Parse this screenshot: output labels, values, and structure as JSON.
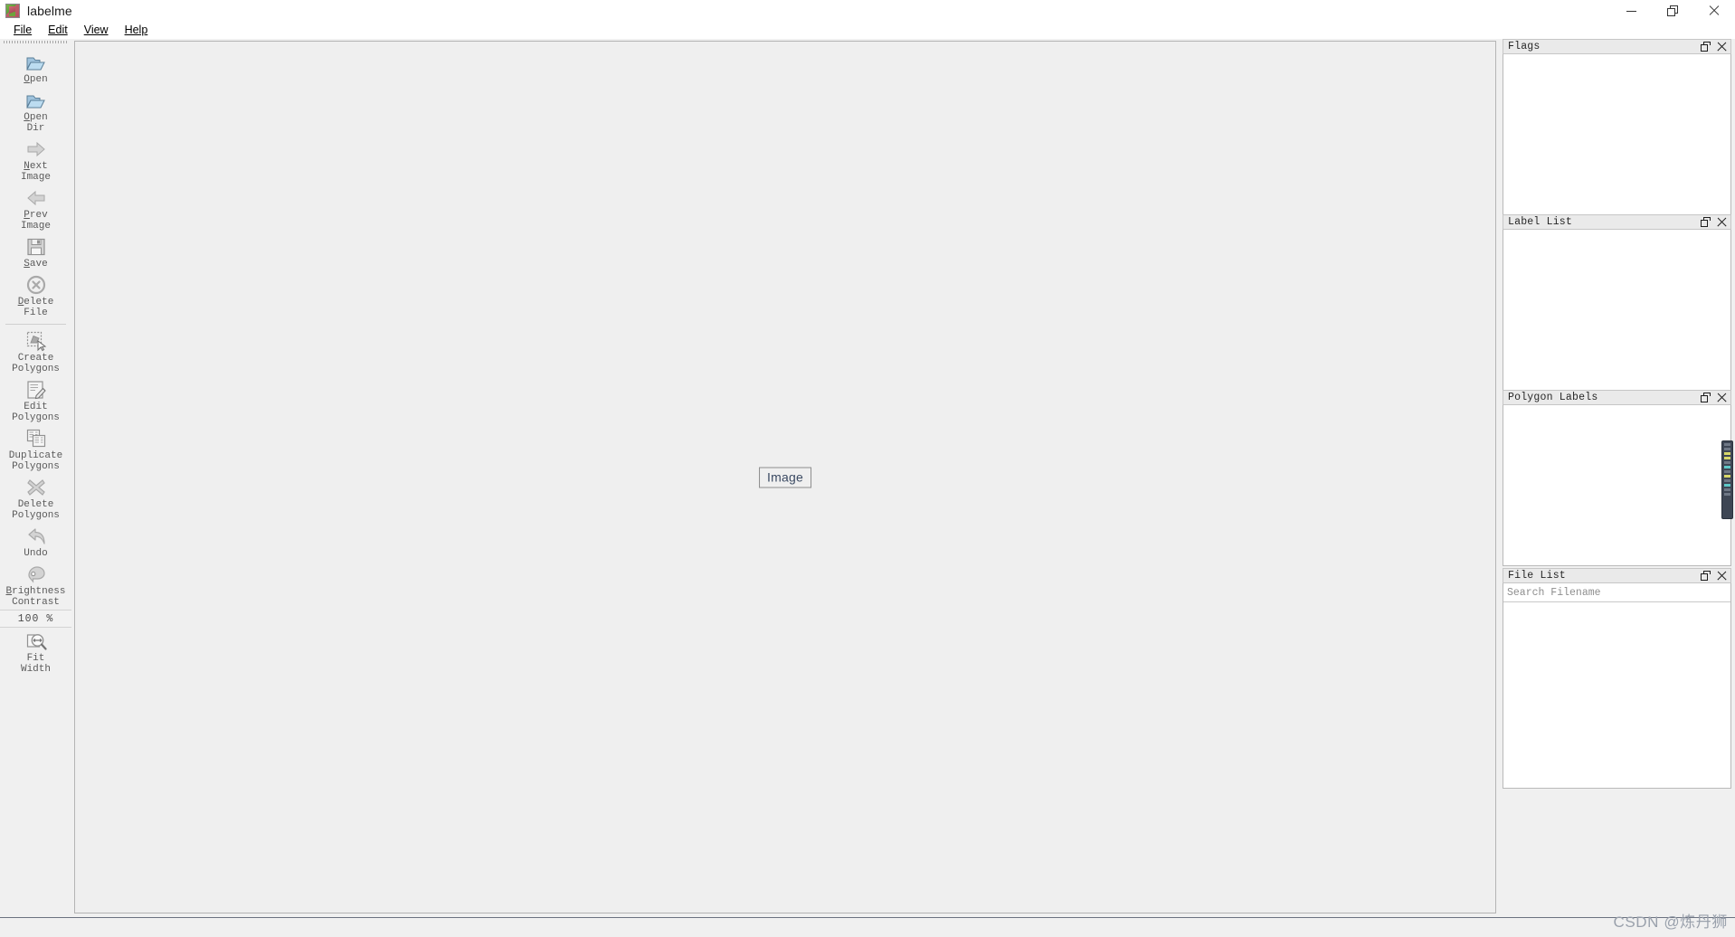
{
  "window": {
    "title": "labelme",
    "icon": "labelme-app-icon",
    "controls": {
      "minimize": "minimize-icon",
      "restore": "restore-icon",
      "close": "close-icon"
    }
  },
  "menubar": {
    "items": [
      {
        "label": "File",
        "mnemonic": "F"
      },
      {
        "label": "Edit",
        "mnemonic": "E"
      },
      {
        "label": "View",
        "mnemonic": "V"
      },
      {
        "label": "Help",
        "mnemonic": "H"
      }
    ]
  },
  "toolbar": {
    "items": [
      {
        "id": "open",
        "label": "Open",
        "icon": "open-folder-icon",
        "enabled": true,
        "mnemonic": "O"
      },
      {
        "id": "open-dir",
        "label": "Open\nDir",
        "icon": "open-folder-icon",
        "enabled": true,
        "mnemonic": "O"
      },
      {
        "id": "next-image",
        "label": "Next\nImage",
        "icon": "arrow-right-icon",
        "enabled": false,
        "mnemonic": "N"
      },
      {
        "id": "prev-image",
        "label": "Prev\nImage",
        "icon": "arrow-left-icon",
        "enabled": false,
        "mnemonic": "P"
      },
      {
        "id": "save",
        "label": "Save",
        "icon": "floppy-disk-icon",
        "enabled": false,
        "mnemonic": "S"
      },
      {
        "id": "delete-file",
        "label": "Delete\nFile",
        "icon": "circle-x-icon",
        "enabled": false,
        "mnemonic": "D"
      },
      {
        "id": "create-polygons",
        "label": "Create\nPolygons",
        "icon": "create-polygon-icon",
        "enabled": false,
        "mnemonic": ""
      },
      {
        "id": "edit-polygons",
        "label": "Edit\nPolygons",
        "icon": "edit-pencil-icon",
        "enabled": false,
        "mnemonic": ""
      },
      {
        "id": "duplicate-polygons",
        "label": "Duplicate\nPolygons",
        "icon": "duplicate-icon",
        "enabled": false,
        "mnemonic": ""
      },
      {
        "id": "delete-polygons",
        "label": "Delete\nPolygons",
        "icon": "x-cross-icon",
        "enabled": false,
        "mnemonic": ""
      },
      {
        "id": "undo",
        "label": "Undo",
        "icon": "undo-arrow-icon",
        "enabled": false,
        "mnemonic": ""
      },
      {
        "id": "brightness-contrast",
        "label": "Brightness\nContrast",
        "icon": "brightness-icon",
        "enabled": false,
        "mnemonic": "B"
      },
      {
        "id": "fit-width",
        "label": "Fit\nWidth",
        "icon": "fit-width-magnifier-icon",
        "enabled": false,
        "mnemonic": "W"
      }
    ],
    "zoom_value": "100 %"
  },
  "canvas": {
    "placeholder_label": "Image"
  },
  "docks": [
    {
      "id": "flags",
      "title": "Flags",
      "float_icon": "float-dock-icon",
      "close_icon": "close-dock-icon",
      "items": []
    },
    {
      "id": "label-list",
      "title": "Label List",
      "float_icon": "float-dock-icon",
      "close_icon": "close-dock-icon",
      "items": []
    },
    {
      "id": "polygon-labels",
      "title": "Polygon Labels",
      "float_icon": "float-dock-icon",
      "close_icon": "close-dock-icon",
      "items": []
    },
    {
      "id": "file-list",
      "title": "File List",
      "float_icon": "float-dock-icon",
      "close_icon": "close-dock-icon",
      "search_placeholder": "Search Filename",
      "search_value": "",
      "items": []
    }
  ],
  "watermark": {
    "text": "CSDN @炼丹狮"
  },
  "colors": {
    "window_bg": "#f0f0f0",
    "canvas_bg": "#efefef",
    "dock_title_bg": "#eaeaea",
    "panel_white": "#ffffff",
    "label_text": "#5a5a5a",
    "border": "#b9b9b9"
  }
}
